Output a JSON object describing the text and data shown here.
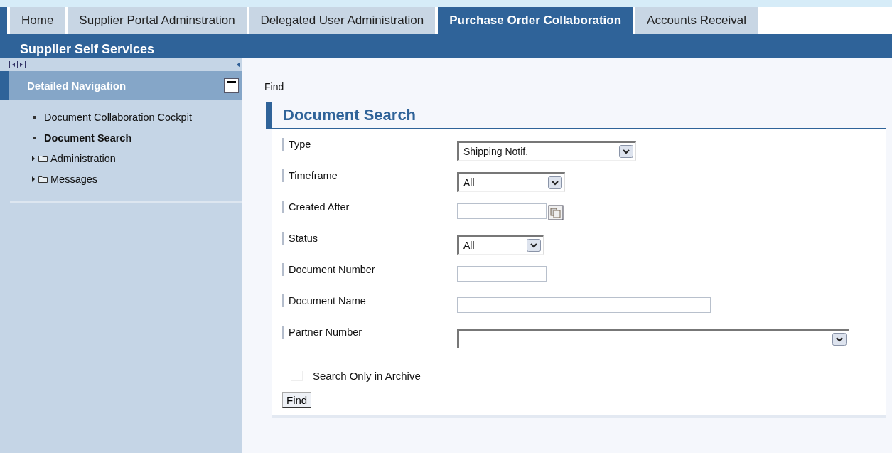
{
  "tabs": [
    {
      "label": "Home",
      "selected": false
    },
    {
      "label": "Supplier Portal Adminstration",
      "selected": false
    },
    {
      "label": "Delegated User Administration",
      "selected": false
    },
    {
      "label": "Purchase Order Collaboration",
      "selected": true
    },
    {
      "label": "Accounts Receival",
      "selected": false
    }
  ],
  "portal_title": "Supplier Self Services",
  "navigation": {
    "title": "Detailed Navigation",
    "items": [
      {
        "kind": "page",
        "label": "Document Collaboration Cockpit",
        "selected": false
      },
      {
        "kind": "page",
        "label": "Document Search",
        "selected": true
      },
      {
        "kind": "folder",
        "label": "Administration",
        "selected": false,
        "expanded": false
      },
      {
        "kind": "folder",
        "label": "Messages",
        "selected": false,
        "expanded": false
      }
    ]
  },
  "breadcrumb": "Find",
  "form": {
    "title": "Document Search",
    "fields": [
      {
        "label": "Type",
        "kind": "select",
        "value": "Shipping Notif."
      },
      {
        "label": "Timeframe",
        "kind": "select",
        "value": "All"
      },
      {
        "label": "Created After",
        "kind": "date"
      },
      {
        "label": "Status",
        "kind": "select",
        "value": "All"
      },
      {
        "label": "Document Number",
        "kind": "text"
      },
      {
        "label": "Document Name",
        "kind": "text"
      },
      {
        "label": "Partner Number",
        "kind": "select"
      }
    ],
    "archive_checkbox": {
      "label": "Search Only in Archive",
      "checked": false
    },
    "button": "Find"
  }
}
